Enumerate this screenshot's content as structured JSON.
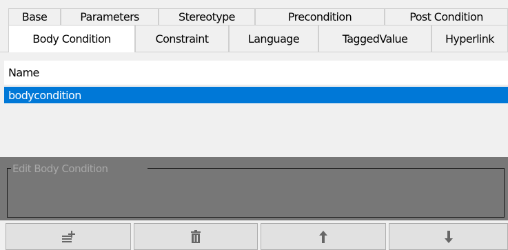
{
  "tabs_row1": [
    "Base",
    "Parameters",
    "Stereotype",
    "Precondition",
    "Post Condition"
  ],
  "tabs_row2": [
    "Body Condition",
    "Constraint",
    "Language",
    "TaggedValue",
    "Hyperlink"
  ],
  "active_tab": "Body Condition",
  "list": {
    "header": "Name",
    "rows": [
      "bodycondition"
    ],
    "selected_row": "bodycondition"
  },
  "edit_group": {
    "legend": "Edit Body Condition"
  },
  "toolbar": {
    "buttons": [
      {
        "name": "add-button",
        "icon": "add-line-icon"
      },
      {
        "name": "delete-button",
        "icon": "trash-icon"
      },
      {
        "name": "move-up-button",
        "icon": "arrow-up-icon"
      },
      {
        "name": "move-down-button",
        "icon": "arrow-down-icon"
      }
    ]
  },
  "colors": {
    "selection": "#0078d7",
    "edit_panel": "#777777",
    "background": "#f0f0f0"
  }
}
